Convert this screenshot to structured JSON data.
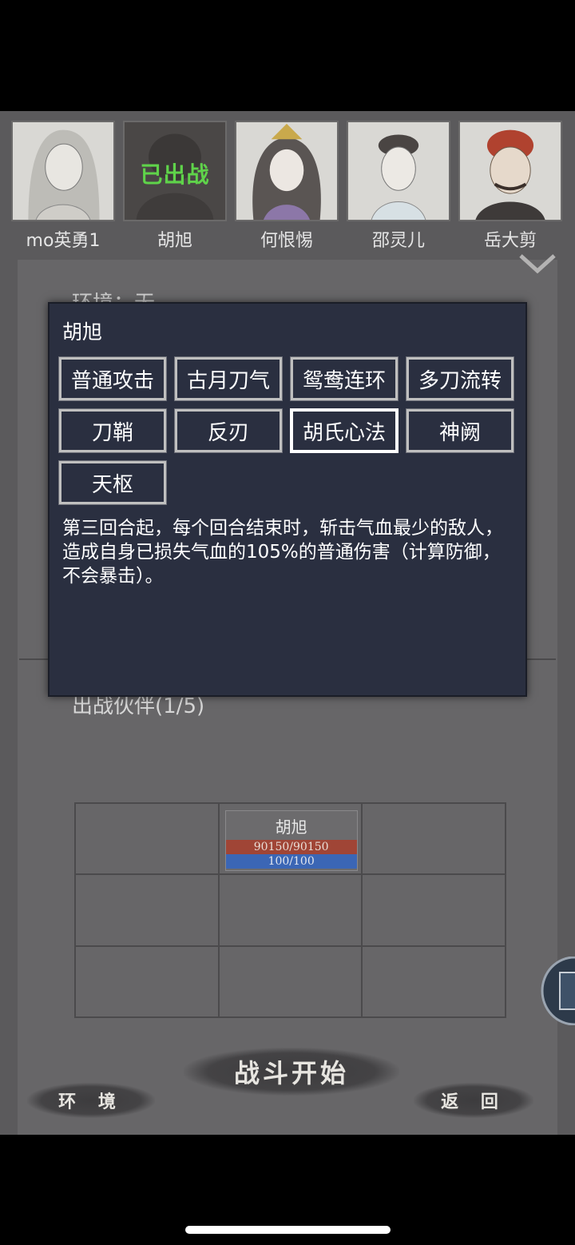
{
  "heroes": [
    {
      "name": "mo英勇1",
      "deployed": false
    },
    {
      "name": "胡旭",
      "deployed": true,
      "tag": "已出战"
    },
    {
      "name": "何恨惕",
      "deployed": false
    },
    {
      "name": "邵灵儿",
      "deployed": false
    },
    {
      "name": "岳大剪",
      "deployed": false
    }
  ],
  "environment_partial": "环境：无",
  "team_label": "出战伙伴(1/5)",
  "formation": {
    "unit": {
      "name": "胡旭",
      "hp": "90150/90150",
      "mp": "100/100"
    }
  },
  "popup": {
    "title": "胡旭",
    "skills": [
      "普通攻击",
      "古月刀气",
      "鸳鸯连环",
      "多刀流转",
      "刀鞘",
      "反刃",
      "胡氏心法",
      "神阙",
      "天枢"
    ],
    "selected_skill": "胡氏心法",
    "description": "第三回合起，每个回合结束时，斩击气血最少的敌人，造成自身已损失气血的105%的普通伤害（计算防御，不会暴击）。"
  },
  "buttons": {
    "start": "战斗开始",
    "environment": "环 境",
    "back": "返 回"
  },
  "colors": {
    "deployed_tag": "#5fd34a",
    "hp_bar": "#a04536",
    "mp_bar": "#3b66b5",
    "popup_bg": "#2a2f40"
  }
}
